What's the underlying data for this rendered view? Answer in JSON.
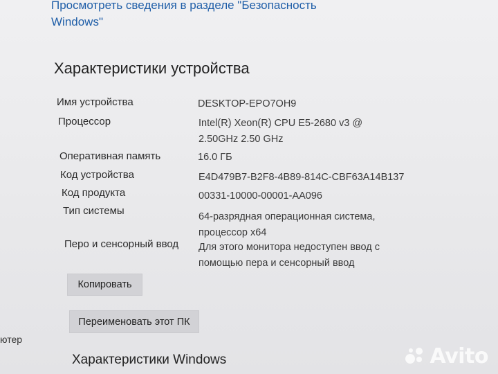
{
  "top_link": "Просмотреть сведения в разделе \"Безопасность Windows\"",
  "device_specs": {
    "title": "Характеристики устройства",
    "rows": [
      {
        "label": "Имя устройства",
        "value": "DESKTOP-EPO7OH9"
      },
      {
        "label": "Процессор",
        "value": "Intel(R) Xeon(R) CPU E5-2680 v3 @ 2.50GHz   2.50 GHz"
      },
      {
        "label": "Оперативная память",
        "value": "16.0 ГБ"
      },
      {
        "label": "Код устройства",
        "value": "E4D479B7-B2F8-4B89-814C-CBF63A14B137"
      },
      {
        "label": "Код продукта",
        "value": "00331-10000-00001-AA096"
      },
      {
        "label": "Тип системы",
        "value": "64-разрядная операционная система, процессор x64"
      },
      {
        "label": "Перо и сенсорный ввод",
        "value": "Для этого монитора недоступен ввод с помощью пера и сенсорный ввод"
      }
    ],
    "copy_button": "Копировать",
    "rename_button": "Переименовать этот ПК"
  },
  "left_fragment": "ютер",
  "windows_specs": {
    "title": "Характеристики Windows"
  },
  "watermark": {
    "text": "Avito",
    "icon": "avito-logo-icon"
  },
  "colors": {
    "link": "#1f5ea8",
    "background": "#e9e9ea",
    "button": "#d2d2d6"
  }
}
